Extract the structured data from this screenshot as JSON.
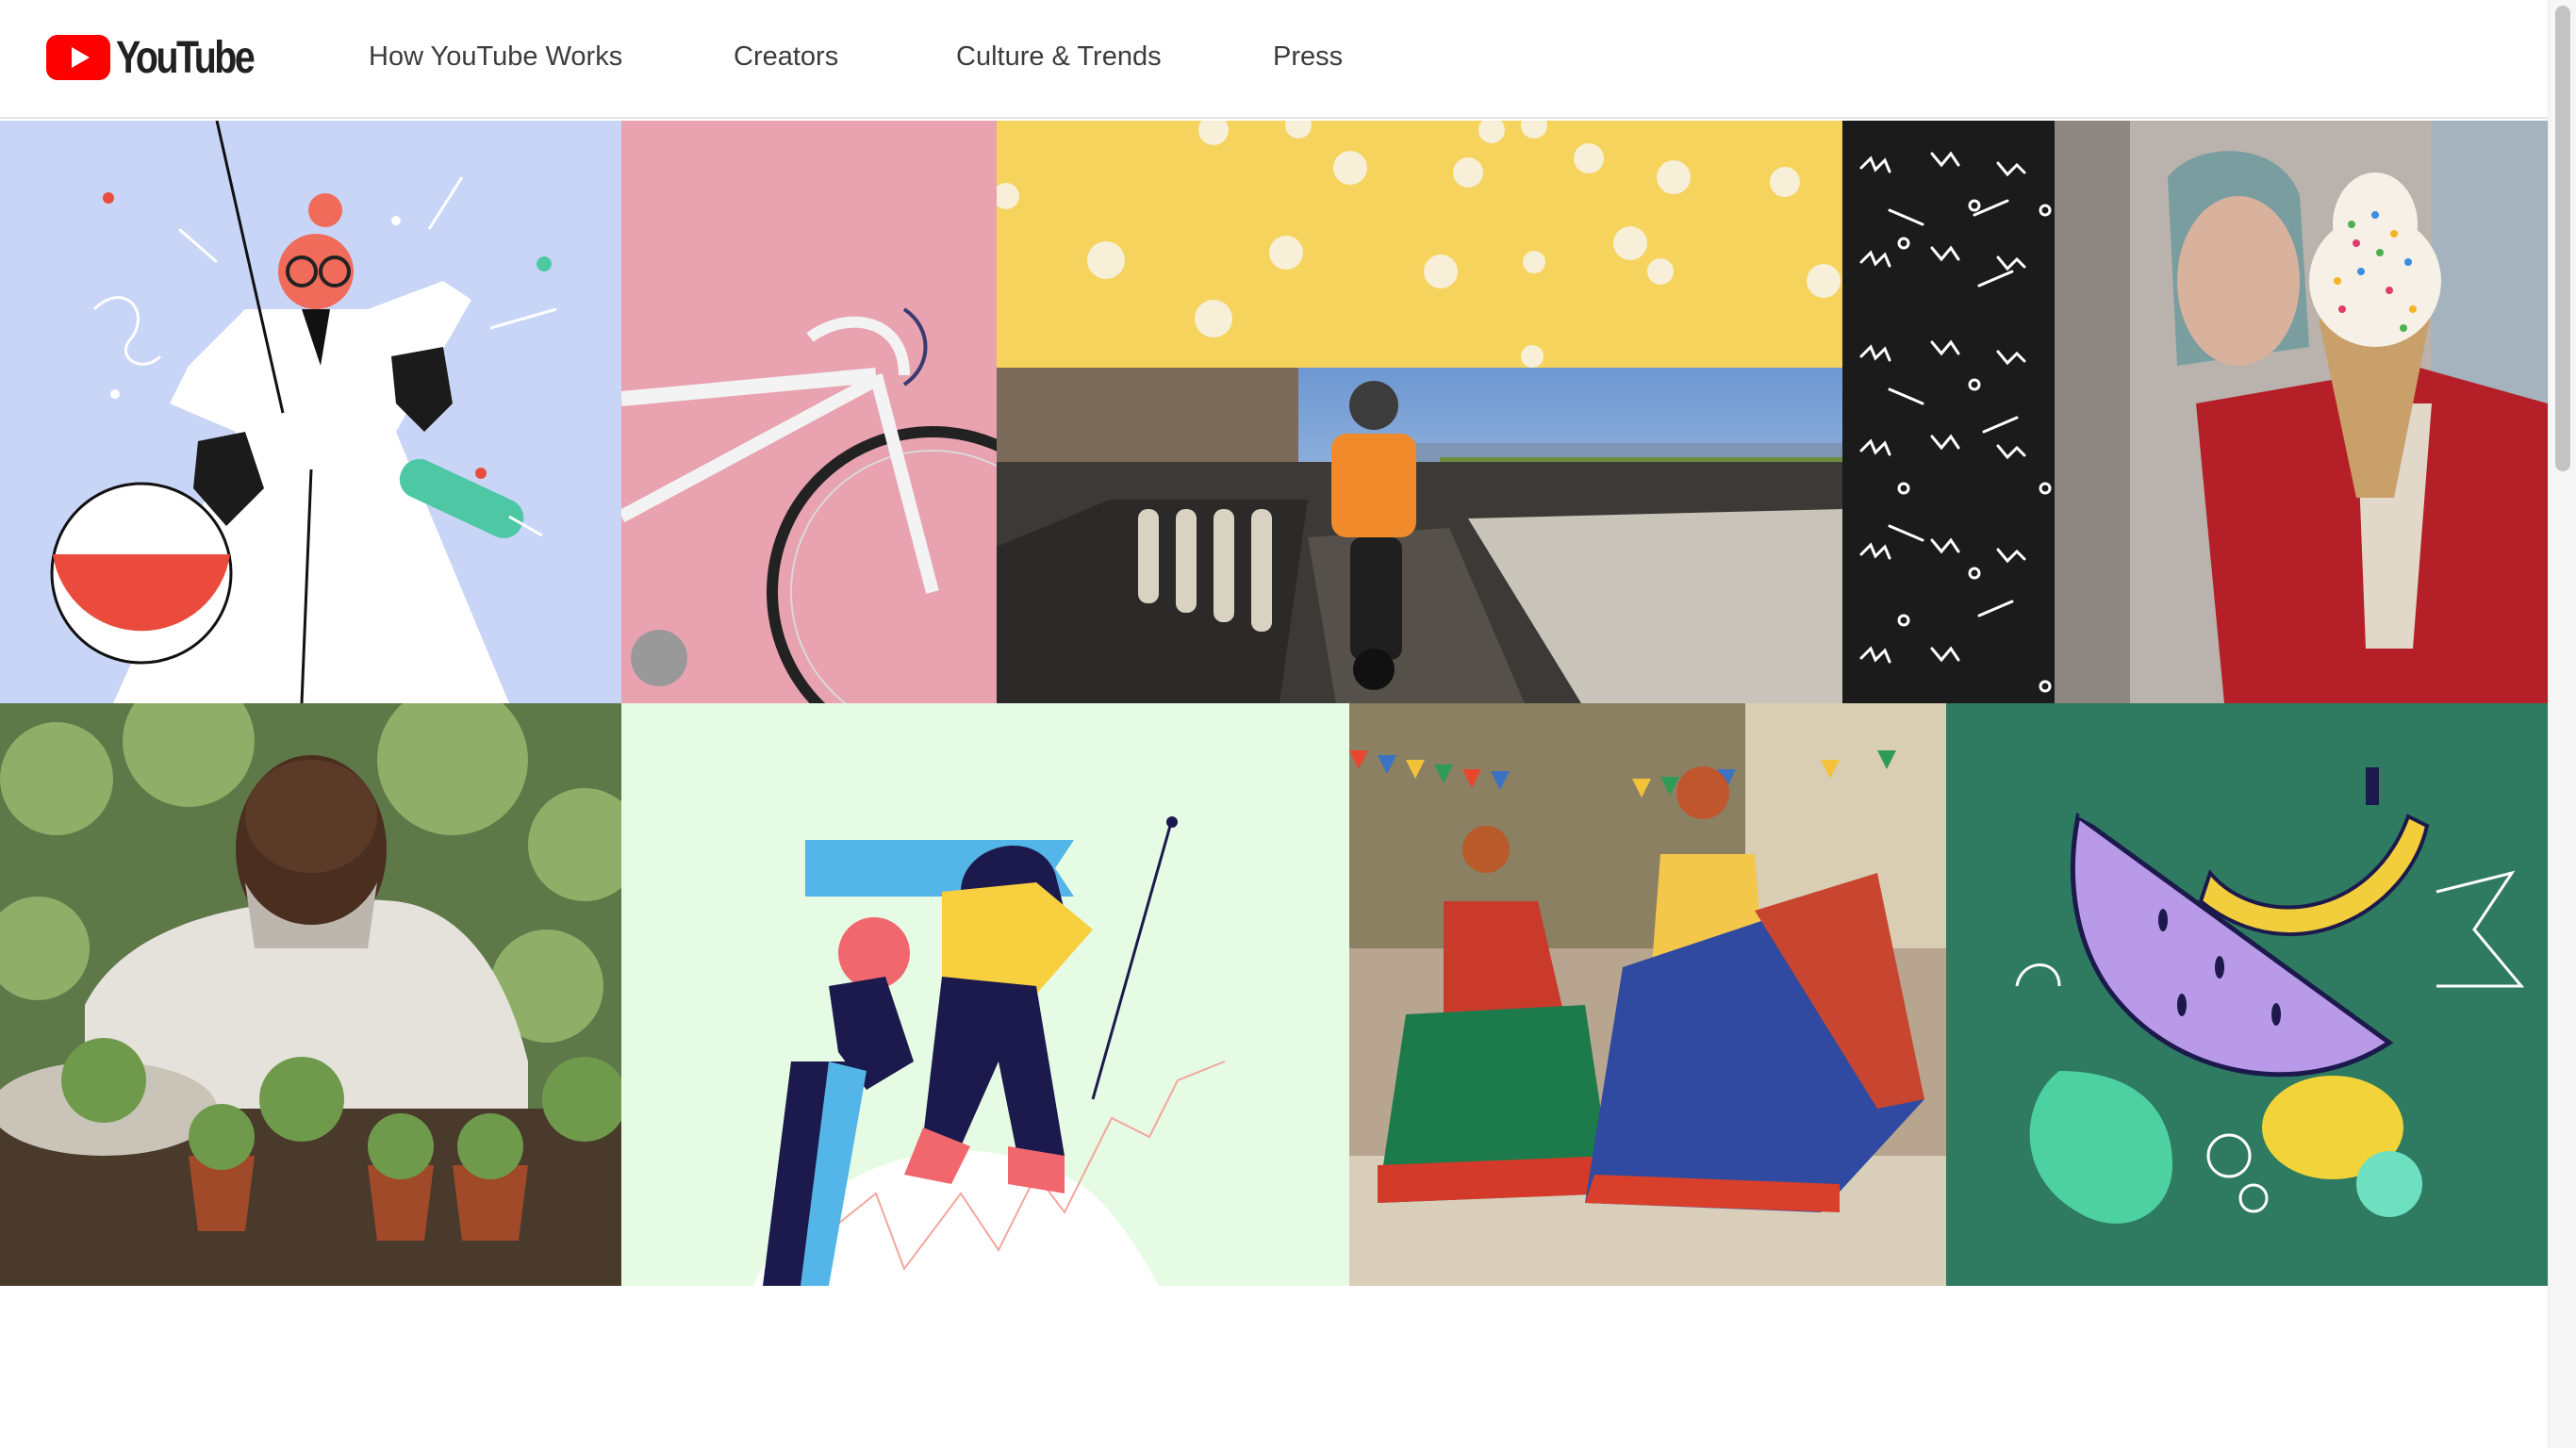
{
  "brand": {
    "name": "YouTube",
    "logo_color": "#ff0000"
  },
  "nav": {
    "items": [
      {
        "label": "How YouTube Works"
      },
      {
        "label": "Creators"
      },
      {
        "label": "Culture & Trends"
      },
      {
        "label": "Press"
      }
    ]
  },
  "mosaic": {
    "tiles": [
      {
        "name": "scientist-illustration",
        "bg": "#c8d5f7"
      },
      {
        "name": "bicycle-photo",
        "bg": "#e8a2b0"
      },
      {
        "name": "popcorn-photo",
        "bg": "#f5d35c"
      },
      {
        "name": "motorbike-river-photo",
        "bg": "#8aa5c5"
      },
      {
        "name": "squiggle-pattern",
        "bg": "#1b1b1b"
      },
      {
        "name": "ice-cream-photo",
        "bg": "#b9b2ad"
      },
      {
        "name": "gardener-photo",
        "bg": "#5e7848"
      },
      {
        "name": "climbers-illustration",
        "bg": "#e5fbe3"
      },
      {
        "name": "dancers-photo",
        "bg": "#b7a58f"
      },
      {
        "name": "fruit-illustration",
        "bg": "#2e7b61"
      }
    ]
  }
}
